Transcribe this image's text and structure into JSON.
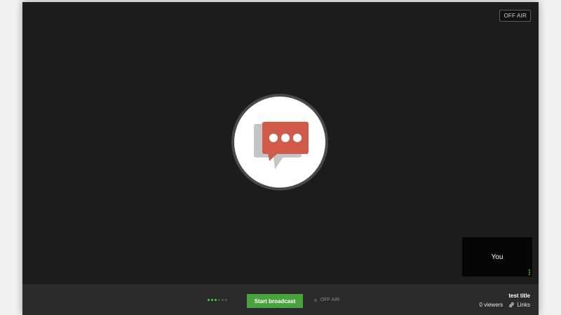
{
  "stage": {
    "status_badge": "OFF AIR",
    "center_icon": "chat-bubble-icon"
  },
  "self_preview": {
    "label": "You",
    "menu_icon": "vertical-dots-icon"
  },
  "control_bar": {
    "signal_level": 3,
    "signal_max": 6,
    "start_label": "Start broadcast",
    "air_status": "OFF AIR"
  },
  "info": {
    "title": "test title",
    "viewers": "0 viewers",
    "links_label": "Links",
    "links_icon": "link-icon"
  },
  "colors": {
    "accent_green": "#48a33e",
    "signal_green": "#39d23a",
    "chat_red": "#d05b4b",
    "chat_gray": "#c5c5c5"
  }
}
